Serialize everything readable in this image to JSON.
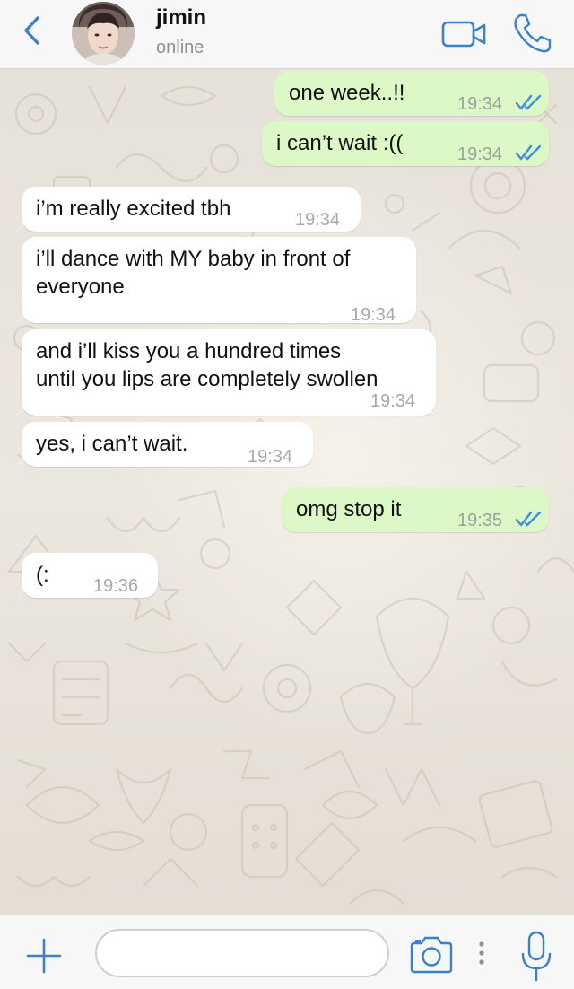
{
  "header": {
    "contact_name": "jimin",
    "contact_status": "online",
    "icons": {
      "back": "chevron-left-icon",
      "video": "video-camera-icon",
      "call": "phone-icon"
    }
  },
  "messages": [
    {
      "direction": "out",
      "text": "one week..!!",
      "time": "19:34",
      "read": true
    },
    {
      "direction": "out",
      "text": "i can’t wait :((",
      "time": "19:34",
      "read": true
    },
    {
      "direction": "in",
      "text": "i’m really excited tbh",
      "time": "19:34"
    },
    {
      "direction": "in",
      "text_lines": [
        "i’ll dance with MY baby in front of",
        "everyone"
      ],
      "time": "19:34"
    },
    {
      "direction": "in",
      "text_lines": [
        "and i’ll kiss you a hundred times",
        "until you lips are completely swollen"
      ],
      "time": "19:34"
    },
    {
      "direction": "in",
      "text": "yes, i can’t wait.",
      "time": "19:34"
    },
    {
      "direction": "out",
      "text": "omg stop it",
      "time": "19:35",
      "read": true
    },
    {
      "direction": "in",
      "text": "(:",
      "time": "19:36"
    }
  ],
  "footer": {
    "input_value": "",
    "icons": {
      "attach": "plus-icon",
      "camera": "camera-icon",
      "more": "more-dots-icon",
      "mic": "microphone-icon"
    }
  },
  "colors": {
    "accent": "#3b7fd0",
    "outgoing_bubble": "#dcf8c6",
    "incoming_bubble": "#ffffff",
    "read_ticks": "#3f8fe0"
  }
}
